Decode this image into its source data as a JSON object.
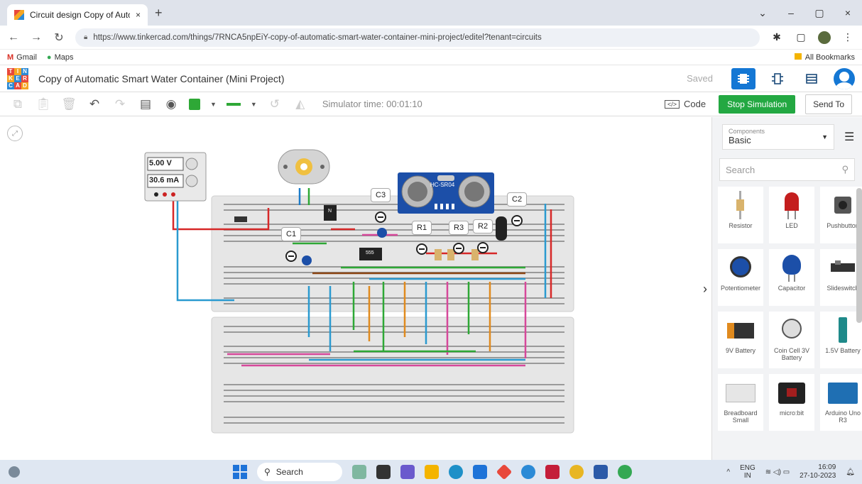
{
  "browser": {
    "tab_title": "Circuit design Copy of Automat",
    "tab_close": "×",
    "new_tab": "+",
    "url": "https://www.tinkercad.com/things/7RNCA5npEiY-copy-of-automatic-smart-water-container-mini-project/editel?tenant=circuits",
    "bookmarks": [
      {
        "label": "Gmail",
        "icon": "M"
      },
      {
        "label": "Maps",
        "icon": "maps-pin"
      }
    ],
    "all_bookmarks": "All Bookmarks",
    "window_controls": {
      "chevron": "⌄",
      "minimize": "–",
      "maximize": "▢",
      "close": "×"
    }
  },
  "tinkercad": {
    "logo_letters": [
      "T",
      "I",
      "N",
      "K",
      "E",
      "R",
      "C",
      "A",
      "D"
    ],
    "design_title": "Copy of Automatic Smart Water Container (Mini Project)",
    "saved": "Saved"
  },
  "toolbar": {
    "simulator_time": "Simulator time: 00:01:10",
    "code_label": "Code",
    "stop_simulation": "Stop Simulation",
    "send_to": "Send To",
    "wire_color": "#2ea836"
  },
  "circuit": {
    "power_supply": {
      "voltage": "5.00 V",
      "current": "30.6 mA"
    },
    "labels": {
      "c1": "C1",
      "c2": "C2",
      "c3": "C3",
      "r1": "R1",
      "r2": "R2",
      "r3": "R3"
    },
    "sensor_label": "HC-SR04",
    "ic_label": "555",
    "transistor_label": "N"
  },
  "panel": {
    "category_caption": "Components",
    "category_value": "Basic",
    "search_placeholder": "Search",
    "components": [
      {
        "label": "Resistor",
        "icon": "resistor-icon"
      },
      {
        "label": "LED",
        "icon": "led-icon"
      },
      {
        "label": "Pushbutton",
        "icon": "pushbutton-icon"
      },
      {
        "label": "Potentiometer",
        "icon": "potentiometer-icon"
      },
      {
        "label": "Capacitor",
        "icon": "capacitor-icon"
      },
      {
        "label": "Slideswitch",
        "icon": "slideswitch-icon"
      },
      {
        "label": "9V Battery",
        "icon": "battery-9v-icon"
      },
      {
        "label": "Coin Cell 3V Battery",
        "icon": "coin-cell-icon"
      },
      {
        "label": "1.5V Battery",
        "icon": "battery-aa-icon"
      },
      {
        "label": "Breadboard Small",
        "icon": "breadboard-icon"
      },
      {
        "label": "micro:bit",
        "icon": "microbit-icon"
      },
      {
        "label": "Arduino Uno R3",
        "icon": "arduino-icon"
      }
    ]
  },
  "taskbar": {
    "search_label": "Search",
    "lang_top": "ENG",
    "lang_bottom": "IN",
    "time": "16:09",
    "date": "27-10-2023"
  }
}
